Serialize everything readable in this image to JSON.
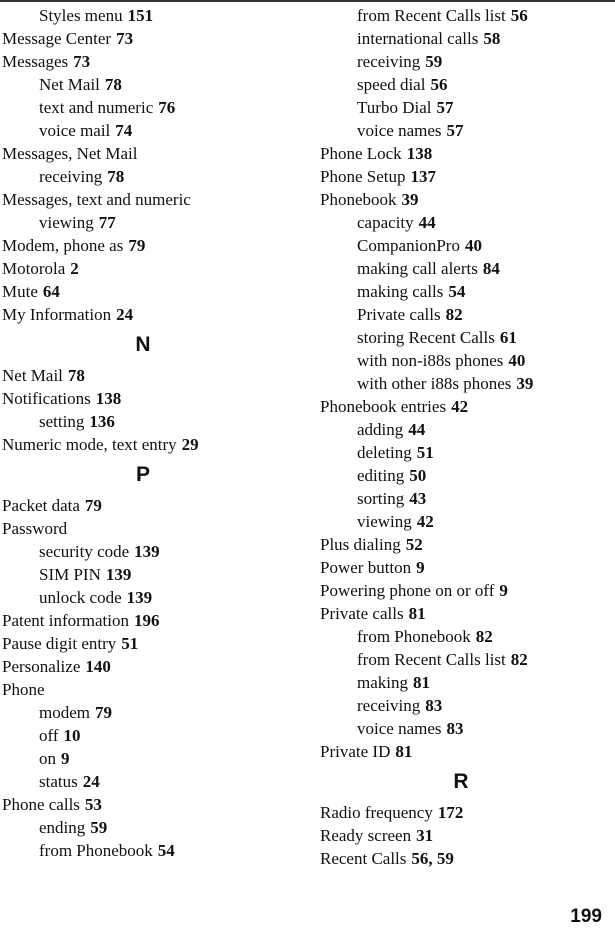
{
  "page_number": "199",
  "columns": [
    {
      "entries": [
        {
          "kind": "sub",
          "term": "Styles menu",
          "pages": "151"
        },
        {
          "kind": "main",
          "term": "Message Center",
          "pages": "73"
        },
        {
          "kind": "main",
          "term": "Messages",
          "pages": "73"
        },
        {
          "kind": "sub",
          "term": "Net Mail",
          "pages": "78"
        },
        {
          "kind": "sub",
          "term": "text and numeric",
          "pages": "76"
        },
        {
          "kind": "sub",
          "term": "voice mail",
          "pages": "74"
        },
        {
          "kind": "main",
          "term": "Messages, Net Mail",
          "pages": ""
        },
        {
          "kind": "sub",
          "term": "receiving",
          "pages": "78"
        },
        {
          "kind": "main",
          "term": "Messages, text and numeric",
          "pages": ""
        },
        {
          "kind": "sub",
          "term": "viewing",
          "pages": "77"
        },
        {
          "kind": "main",
          "term": "Modem, phone as",
          "pages": "79"
        },
        {
          "kind": "main",
          "term": "Motorola",
          "pages": "2"
        },
        {
          "kind": "main",
          "term": "Mute",
          "pages": "64"
        },
        {
          "kind": "main",
          "term": "My Information",
          "pages": "24"
        },
        {
          "kind": "letter",
          "term": "N",
          "pages": ""
        },
        {
          "kind": "main",
          "term": "Net Mail",
          "pages": "78"
        },
        {
          "kind": "main",
          "term": "Notifications",
          "pages": "138"
        },
        {
          "kind": "sub",
          "term": "setting",
          "pages": "136"
        },
        {
          "kind": "main",
          "term": "Numeric mode, text entry",
          "pages": "29"
        },
        {
          "kind": "letter",
          "term": "P",
          "pages": ""
        },
        {
          "kind": "main",
          "term": "Packet data",
          "pages": "79"
        },
        {
          "kind": "main",
          "term": "Password",
          "pages": ""
        },
        {
          "kind": "sub",
          "term": "security code",
          "pages": "139"
        },
        {
          "kind": "sub",
          "term": "SIM PIN",
          "pages": "139"
        },
        {
          "kind": "sub",
          "term": "unlock code",
          "pages": "139"
        },
        {
          "kind": "main",
          "term": "Patent information",
          "pages": "196"
        },
        {
          "kind": "main",
          "term": "Pause digit entry",
          "pages": "51"
        },
        {
          "kind": "main",
          "term": "Personalize",
          "pages": "140"
        },
        {
          "kind": "main",
          "term": "Phone",
          "pages": ""
        },
        {
          "kind": "sub",
          "term": "modem",
          "pages": "79"
        },
        {
          "kind": "sub",
          "term": "off",
          "pages": "10"
        },
        {
          "kind": "sub",
          "term": "on",
          "pages": "9"
        },
        {
          "kind": "sub",
          "term": "status",
          "pages": "24"
        },
        {
          "kind": "main",
          "term": "Phone calls",
          "pages": "53"
        },
        {
          "kind": "sub",
          "term": "ending",
          "pages": "59"
        },
        {
          "kind": "sub",
          "term": "from Phonebook",
          "pages": "54"
        }
      ]
    },
    {
      "entries": [
        {
          "kind": "sub",
          "term": "from Recent Calls list",
          "pages": "56"
        },
        {
          "kind": "sub",
          "term": "international calls",
          "pages": "58"
        },
        {
          "kind": "sub",
          "term": "receiving",
          "pages": "59"
        },
        {
          "kind": "sub",
          "term": "speed dial",
          "pages": "56"
        },
        {
          "kind": "sub",
          "term": "Turbo Dial",
          "pages": "57"
        },
        {
          "kind": "sub",
          "term": "voice names",
          "pages": "57"
        },
        {
          "kind": "main",
          "term": "Phone Lock",
          "pages": "138"
        },
        {
          "kind": "main",
          "term": "Phone Setup",
          "pages": "137"
        },
        {
          "kind": "main",
          "term": "Phonebook",
          "pages": "39"
        },
        {
          "kind": "sub",
          "term": "capacity",
          "pages": "44"
        },
        {
          "kind": "sub",
          "term": "CompanionPro",
          "pages": "40"
        },
        {
          "kind": "sub",
          "term": "making call alerts",
          "pages": "84"
        },
        {
          "kind": "sub",
          "term": "making calls",
          "pages": "54"
        },
        {
          "kind": "sub",
          "term": "Private calls",
          "pages": "82"
        },
        {
          "kind": "sub",
          "term": "storing Recent Calls",
          "pages": "61"
        },
        {
          "kind": "sub",
          "term": "with non-i88s phones",
          "pages": "40"
        },
        {
          "kind": "sub",
          "term": "with other i88s phones",
          "pages": "39"
        },
        {
          "kind": "main",
          "term": "Phonebook entries",
          "pages": "42"
        },
        {
          "kind": "sub",
          "term": "adding",
          "pages": "44"
        },
        {
          "kind": "sub",
          "term": "deleting",
          "pages": "51"
        },
        {
          "kind": "sub",
          "term": "editing",
          "pages": "50"
        },
        {
          "kind": "sub",
          "term": "sorting",
          "pages": "43"
        },
        {
          "kind": "sub",
          "term": "viewing",
          "pages": "42"
        },
        {
          "kind": "main",
          "term": "Plus dialing",
          "pages": "52"
        },
        {
          "kind": "main",
          "term": "Power button",
          "pages": "9"
        },
        {
          "kind": "main",
          "term": "Powering phone on or off",
          "pages": "9"
        },
        {
          "kind": "main",
          "term": "Private calls",
          "pages": "81"
        },
        {
          "kind": "sub",
          "term": "from Phonebook",
          "pages": "82"
        },
        {
          "kind": "sub",
          "term": "from Recent Calls list",
          "pages": "82"
        },
        {
          "kind": "sub",
          "term": "making",
          "pages": "81"
        },
        {
          "kind": "sub",
          "term": "receiving",
          "pages": "83"
        },
        {
          "kind": "sub",
          "term": "voice names",
          "pages": "83"
        },
        {
          "kind": "main",
          "term": "Private ID",
          "pages": "81"
        },
        {
          "kind": "letter",
          "term": "R",
          "pages": ""
        },
        {
          "kind": "main",
          "term": "Radio frequency",
          "pages": "172"
        },
        {
          "kind": "main",
          "term": "Ready screen",
          "pages": "31"
        },
        {
          "kind": "main",
          "term": "Recent Calls",
          "pages": "56, 59"
        }
      ]
    }
  ]
}
